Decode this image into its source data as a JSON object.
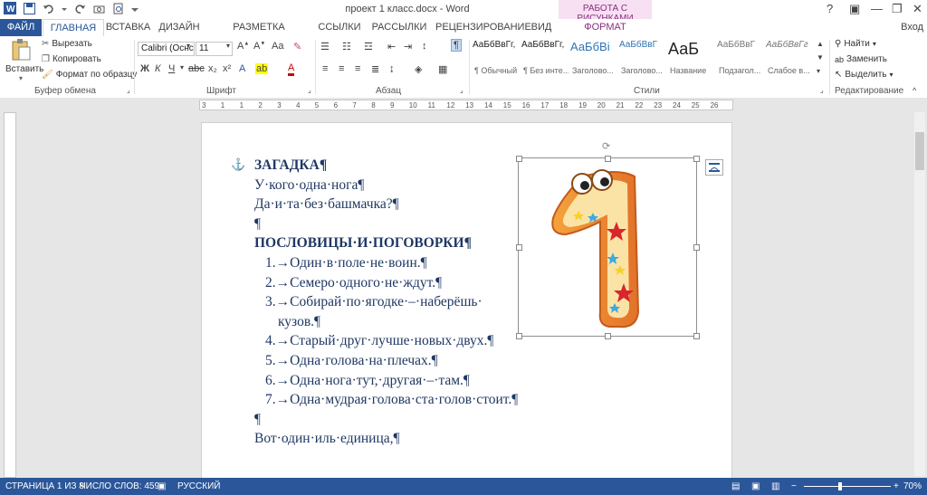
{
  "window": {
    "title": "проект 1 класс.docx - Word",
    "context_group": "РАБОТА С РИСУНКАМИ",
    "login": "Вход"
  },
  "tabs": [
    {
      "label": "ФАЙЛ"
    },
    {
      "label": "ГЛАВНАЯ"
    },
    {
      "label": "ВСТАВКА"
    },
    {
      "label": "ДИЗАЙН"
    },
    {
      "label": "РАЗМЕТКА СТРАНИЦЫ"
    },
    {
      "label": "ССЫЛКИ"
    },
    {
      "label": "РАССЫЛКИ"
    },
    {
      "label": "РЕЦЕНЗИРОВАНИЕ"
    },
    {
      "label": "ВИД"
    },
    {
      "label": "ФОРМАТ"
    }
  ],
  "clipboard": {
    "paste": "Вставить",
    "cut": "Вырезать",
    "copy": "Копировать",
    "format_painter": "Формат по образцу",
    "label": "Буфер обмена"
  },
  "font": {
    "name": "Calibri (Оснс",
    "size": "11",
    "label": "Шрифт"
  },
  "paragraph": {
    "label": "Абзац"
  },
  "styles": {
    "label": "Стили",
    "items": [
      {
        "sample": "АаБбВвГг,",
        "name": "¶ Обычный"
      },
      {
        "sample": "АаБбВвГг,",
        "name": "¶ Без инте..."
      },
      {
        "sample": "АаБбВі",
        "name": "Заголово..."
      },
      {
        "sample": "АаБбВвГ",
        "name": "Заголово..."
      },
      {
        "sample": "АаБ",
        "name": "Название"
      },
      {
        "sample": "АаБбВвГ",
        "name": "Подзагол..."
      },
      {
        "sample": "АаБбВвГг",
        "name": "Слабое в..."
      }
    ]
  },
  "editing": {
    "find": "Найти",
    "replace": "Заменить",
    "select": "Выделить",
    "label": "Редактирование"
  },
  "ruler": {
    "numbers": [
      "3",
      "1",
      "1",
      "2",
      "3",
      "4",
      "5",
      "6",
      "7",
      "8",
      "9",
      "10",
      "11",
      "12",
      "13",
      "14",
      "15",
      "16",
      "17",
      "18",
      "19",
      "20",
      "21",
      "22",
      "23",
      "24",
      "25",
      "26"
    ]
  },
  "document": {
    "lines": [
      {
        "text": "ЗАГАДКА¶",
        "bold": true,
        "indent": 0
      },
      {
        "text": "У·кого·одна·нога¶",
        "bold": false,
        "indent": 0
      },
      {
        "text": "Да·и·та·без·башмачка?¶",
        "bold": false,
        "indent": 0
      },
      {
        "text": "¶",
        "bold": false,
        "indent": 0
      },
      {
        "text": "ПОСЛОВИЦЫ·И·ПОГОВОРКИ¶",
        "bold": true,
        "indent": 0
      },
      {
        "text": "1.→Один·в·поле·не·воин.¶",
        "bold": false,
        "indent": 1
      },
      {
        "text": "2.→Семеро·одного·не·ждут.¶",
        "bold": false,
        "indent": 1
      },
      {
        "text": "3.→Собирай·по·ягодке·–·наберёшь·",
        "bold": false,
        "indent": 1
      },
      {
        "text": "кузов.¶",
        "bold": false,
        "indent": 2
      },
      {
        "text": "4.→Старый·друг·лучше·новых·двух.¶",
        "bold": false,
        "indent": 1
      },
      {
        "text": "5.→Одна·голова·на·плечах.¶",
        "bold": false,
        "indent": 1
      },
      {
        "text": "6.→Одна·нога·тут,·другая·–·там.¶",
        "bold": false,
        "indent": 1
      },
      {
        "text": "7.→Одна·мудрая·голова·ста·голов·стоит.¶",
        "bold": false,
        "indent": 1
      },
      {
        "text": "¶",
        "bold": false,
        "indent": 0
      },
      {
        "text": "Вот·один·иль·единица,¶",
        "bold": false,
        "indent": 0
      }
    ]
  },
  "status": {
    "page": "СТРАНИЦА 1 ИЗ 8",
    "words": "ЧИСЛО СЛОВ: 459",
    "language": "РУССКИЙ",
    "zoom": "70%"
  },
  "colors": {
    "accent": "#2b579a",
    "context": "#8a2f7f",
    "doc_text": "#1f3864"
  }
}
